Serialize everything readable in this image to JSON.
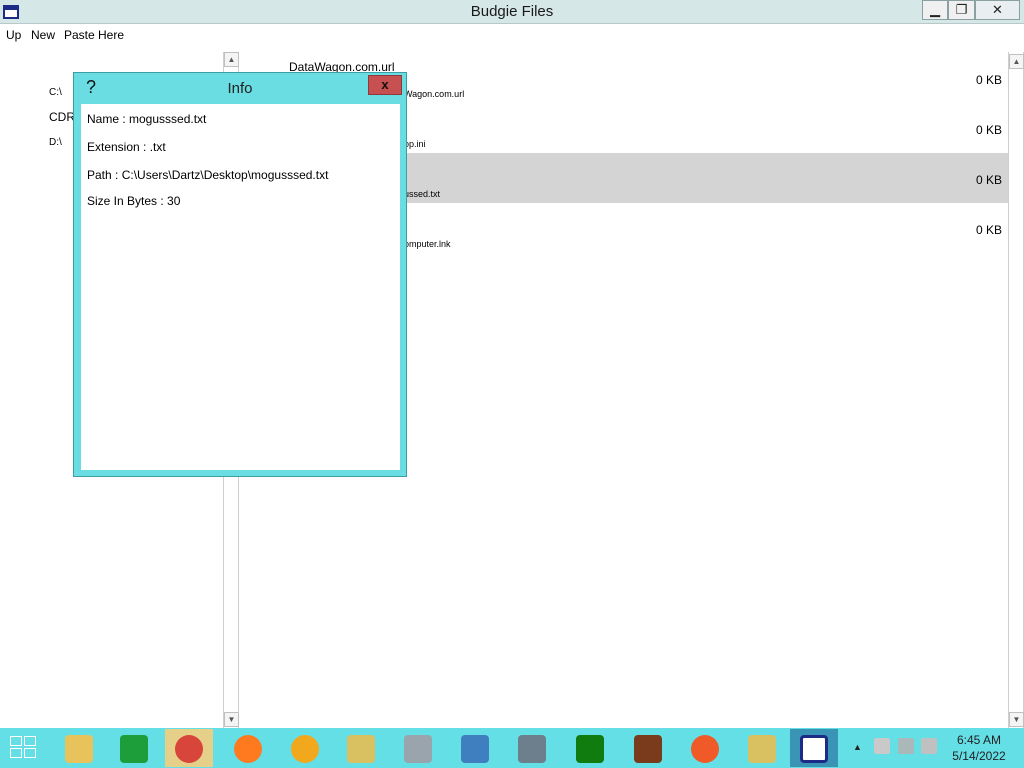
{
  "window": {
    "title": "Budgie Files",
    "min_glyph": "▁",
    "max_glyph": "❐",
    "close_glyph": "✕"
  },
  "menu": {
    "up": "Up",
    "new": "New",
    "paste": "Paste Here"
  },
  "drives": [
    "C:\\",
    "CDR",
    "D:\\"
  ],
  "files": {
    "top_label": "DataWagon.com.url",
    "items": [
      {
        "name": "Wagon.com.url",
        "size": "0 KB",
        "selected": false
      },
      {
        "name": "op.ini",
        "size": "0 KB",
        "selected": false
      },
      {
        "name": "ussed.txt",
        "size": "0 KB",
        "selected": true
      },
      {
        "name": "omputer.lnk",
        "size": "0 KB",
        "selected": false
      }
    ]
  },
  "dialog": {
    "help": "?",
    "title": "Info",
    "close": "x",
    "name": "Name : mogusssed.txt",
    "extension": "Extension : .txt",
    "path": "Path : C:\\Users\\Dartz\\Desktop\\mogusssed.txt",
    "size": "Size In Bytes : 30"
  },
  "taskbar": {
    "icons": [
      {
        "name": "file-explorer-icon",
        "color": "#e8c25a"
      },
      {
        "name": "store-icon",
        "color": "#1e9e3a"
      },
      {
        "name": "chrome-icon",
        "color": "#d8453a"
      },
      {
        "name": "firefox-icon",
        "color": "#ff7a1f"
      },
      {
        "name": "vpn-shield-icon",
        "color": "#f2a81d"
      },
      {
        "name": "archive-icon",
        "color": "#d9c060"
      },
      {
        "name": "tools-icon",
        "color": "#9aa4ad"
      },
      {
        "name": "control-panel-icon",
        "color": "#3f7fc0"
      },
      {
        "name": "server-manager-icon",
        "color": "#6d7f8c"
      },
      {
        "name": "xbox-icon",
        "color": "#107c10"
      },
      {
        "name": "game-icon",
        "color": "#7a3b1c"
      },
      {
        "name": "swift-icon",
        "color": "#f05a28"
      },
      {
        "name": "zip-icon",
        "color": "#d9c060"
      },
      {
        "name": "budgie-files-icon",
        "color": "#1c2c86"
      }
    ],
    "tray_arrow": "▲",
    "time": "6:45 AM",
    "date": "5/14/2022"
  }
}
